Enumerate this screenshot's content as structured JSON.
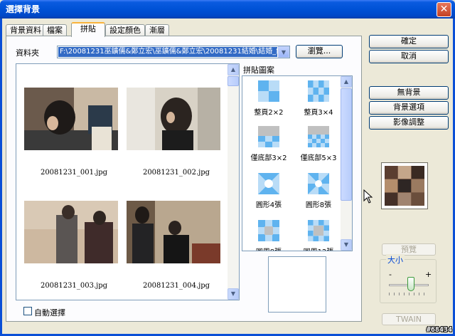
{
  "window": {
    "title": "選擇背景",
    "close_glyph": "✕"
  },
  "tabs": [
    {
      "label": "背景資料",
      "active": false
    },
    {
      "label": "檔案",
      "active": false
    },
    {
      "label": "拼貼",
      "active": true
    },
    {
      "label": "設定顏色",
      "active": false
    },
    {
      "label": "漸層",
      "active": false
    }
  ],
  "folder": {
    "label": "資料夾",
    "path": "F:\\20081231巫鑛儒&鄭立宏\\巫鑛儒&鄭立宏\\20081231結婚\\結婚_縮圖",
    "browse_label": "瀏覽..."
  },
  "thumbnails": [
    {
      "caption": "20081231_001.jpg"
    },
    {
      "caption": "20081231_002.jpg"
    },
    {
      "caption": "20081231_003.jpg"
    },
    {
      "caption": "20081231_004.jpg"
    }
  ],
  "patterns_title": "拼貼圖案",
  "patterns": [
    {
      "label": "整頁2×2",
      "icon": "grid-2x2-icon"
    },
    {
      "label": "整頁3×4",
      "icon": "grid-3x4-icon"
    },
    {
      "label": "僅底部3×2",
      "icon": "bottom-3x2-icon"
    },
    {
      "label": "僅底部5×3",
      "icon": "bottom-5x3-icon"
    },
    {
      "label": "圓形4張",
      "icon": "circle-4-icon"
    },
    {
      "label": "圓形8張",
      "icon": "circle-8-icon"
    },
    {
      "label": "圓周8張",
      "icon": "ring-8-icon"
    },
    {
      "label": "圓周12張",
      "icon": "ring-12-icon"
    }
  ],
  "auto_select_label": "自動選擇",
  "buttons": {
    "ok": "確定",
    "cancel": "取消",
    "no_background": "無背景",
    "background_options": "背景選項",
    "image_adjust": "影像調整",
    "preview": "預覽",
    "twain": "TWAIN"
  },
  "size": {
    "label": "大小",
    "minus": "-",
    "plus": "+",
    "level": 0.55
  },
  "watermark": "#68434",
  "colors": {
    "title_blue": "#0052d6",
    "selection": "#316ac5",
    "pattern_light": "#b9dcf7",
    "pattern_dark": "#5fb3ef"
  }
}
